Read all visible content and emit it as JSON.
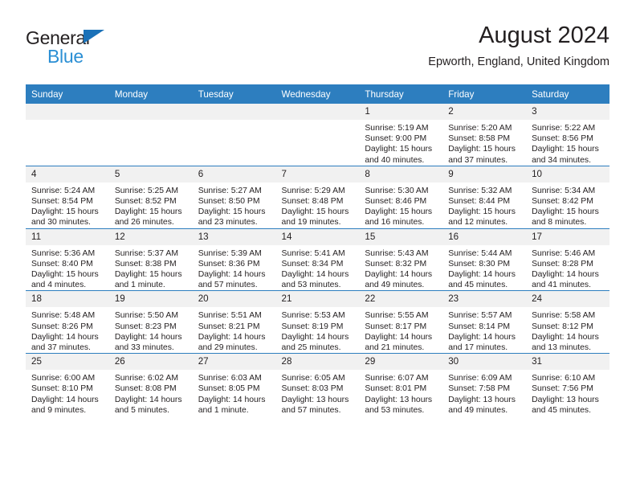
{
  "brand": {
    "name_top": "General",
    "name_bottom": "Blue",
    "triangle_color": "#1a71b8",
    "blue_text_color": "#2b8fd4"
  },
  "header": {
    "title": "August 2024",
    "location": "Epworth, England, United Kingdom"
  },
  "theme": {
    "header_blue": "#2d7ebf",
    "daynum_gray": "#f1f1f1",
    "text": "#231f20"
  },
  "calendar": {
    "weekday_headers": [
      "Sunday",
      "Monday",
      "Tuesday",
      "Wednesday",
      "Thursday",
      "Friday",
      "Saturday"
    ],
    "weeks": [
      [
        {
          "day": "",
          "empty": true
        },
        {
          "day": "",
          "empty": true
        },
        {
          "day": "",
          "empty": true
        },
        {
          "day": "",
          "empty": true
        },
        {
          "day": "1",
          "sunrise": "Sunrise: 5:19 AM",
          "sunset": "Sunset: 9:00 PM",
          "daylight1": "Daylight: 15 hours",
          "daylight2": "and 40 minutes."
        },
        {
          "day": "2",
          "sunrise": "Sunrise: 5:20 AM",
          "sunset": "Sunset: 8:58 PM",
          "daylight1": "Daylight: 15 hours",
          "daylight2": "and 37 minutes."
        },
        {
          "day": "3",
          "sunrise": "Sunrise: 5:22 AM",
          "sunset": "Sunset: 8:56 PM",
          "daylight1": "Daylight: 15 hours",
          "daylight2": "and 34 minutes."
        }
      ],
      [
        {
          "day": "4",
          "sunrise": "Sunrise: 5:24 AM",
          "sunset": "Sunset: 8:54 PM",
          "daylight1": "Daylight: 15 hours",
          "daylight2": "and 30 minutes."
        },
        {
          "day": "5",
          "sunrise": "Sunrise: 5:25 AM",
          "sunset": "Sunset: 8:52 PM",
          "daylight1": "Daylight: 15 hours",
          "daylight2": "and 26 minutes."
        },
        {
          "day": "6",
          "sunrise": "Sunrise: 5:27 AM",
          "sunset": "Sunset: 8:50 PM",
          "daylight1": "Daylight: 15 hours",
          "daylight2": "and 23 minutes."
        },
        {
          "day": "7",
          "sunrise": "Sunrise: 5:29 AM",
          "sunset": "Sunset: 8:48 PM",
          "daylight1": "Daylight: 15 hours",
          "daylight2": "and 19 minutes."
        },
        {
          "day": "8",
          "sunrise": "Sunrise: 5:30 AM",
          "sunset": "Sunset: 8:46 PM",
          "daylight1": "Daylight: 15 hours",
          "daylight2": "and 16 minutes."
        },
        {
          "day": "9",
          "sunrise": "Sunrise: 5:32 AM",
          "sunset": "Sunset: 8:44 PM",
          "daylight1": "Daylight: 15 hours",
          "daylight2": "and 12 minutes."
        },
        {
          "day": "10",
          "sunrise": "Sunrise: 5:34 AM",
          "sunset": "Sunset: 8:42 PM",
          "daylight1": "Daylight: 15 hours",
          "daylight2": "and 8 minutes."
        }
      ],
      [
        {
          "day": "11",
          "sunrise": "Sunrise: 5:36 AM",
          "sunset": "Sunset: 8:40 PM",
          "daylight1": "Daylight: 15 hours",
          "daylight2": "and 4 minutes."
        },
        {
          "day": "12",
          "sunrise": "Sunrise: 5:37 AM",
          "sunset": "Sunset: 8:38 PM",
          "daylight1": "Daylight: 15 hours",
          "daylight2": "and 1 minute."
        },
        {
          "day": "13",
          "sunrise": "Sunrise: 5:39 AM",
          "sunset": "Sunset: 8:36 PM",
          "daylight1": "Daylight: 14 hours",
          "daylight2": "and 57 minutes."
        },
        {
          "day": "14",
          "sunrise": "Sunrise: 5:41 AM",
          "sunset": "Sunset: 8:34 PM",
          "daylight1": "Daylight: 14 hours",
          "daylight2": "and 53 minutes."
        },
        {
          "day": "15",
          "sunrise": "Sunrise: 5:43 AM",
          "sunset": "Sunset: 8:32 PM",
          "daylight1": "Daylight: 14 hours",
          "daylight2": "and 49 minutes."
        },
        {
          "day": "16",
          "sunrise": "Sunrise: 5:44 AM",
          "sunset": "Sunset: 8:30 PM",
          "daylight1": "Daylight: 14 hours",
          "daylight2": "and 45 minutes."
        },
        {
          "day": "17",
          "sunrise": "Sunrise: 5:46 AM",
          "sunset": "Sunset: 8:28 PM",
          "daylight1": "Daylight: 14 hours",
          "daylight2": "and 41 minutes."
        }
      ],
      [
        {
          "day": "18",
          "sunrise": "Sunrise: 5:48 AM",
          "sunset": "Sunset: 8:26 PM",
          "daylight1": "Daylight: 14 hours",
          "daylight2": "and 37 minutes."
        },
        {
          "day": "19",
          "sunrise": "Sunrise: 5:50 AM",
          "sunset": "Sunset: 8:23 PM",
          "daylight1": "Daylight: 14 hours",
          "daylight2": "and 33 minutes."
        },
        {
          "day": "20",
          "sunrise": "Sunrise: 5:51 AM",
          "sunset": "Sunset: 8:21 PM",
          "daylight1": "Daylight: 14 hours",
          "daylight2": "and 29 minutes."
        },
        {
          "day": "21",
          "sunrise": "Sunrise: 5:53 AM",
          "sunset": "Sunset: 8:19 PM",
          "daylight1": "Daylight: 14 hours",
          "daylight2": "and 25 minutes."
        },
        {
          "day": "22",
          "sunrise": "Sunrise: 5:55 AM",
          "sunset": "Sunset: 8:17 PM",
          "daylight1": "Daylight: 14 hours",
          "daylight2": "and 21 minutes."
        },
        {
          "day": "23",
          "sunrise": "Sunrise: 5:57 AM",
          "sunset": "Sunset: 8:14 PM",
          "daylight1": "Daylight: 14 hours",
          "daylight2": "and 17 minutes."
        },
        {
          "day": "24",
          "sunrise": "Sunrise: 5:58 AM",
          "sunset": "Sunset: 8:12 PM",
          "daylight1": "Daylight: 14 hours",
          "daylight2": "and 13 minutes."
        }
      ],
      [
        {
          "day": "25",
          "sunrise": "Sunrise: 6:00 AM",
          "sunset": "Sunset: 8:10 PM",
          "daylight1": "Daylight: 14 hours",
          "daylight2": "and 9 minutes."
        },
        {
          "day": "26",
          "sunrise": "Sunrise: 6:02 AM",
          "sunset": "Sunset: 8:08 PM",
          "daylight1": "Daylight: 14 hours",
          "daylight2": "and 5 minutes."
        },
        {
          "day": "27",
          "sunrise": "Sunrise: 6:03 AM",
          "sunset": "Sunset: 8:05 PM",
          "daylight1": "Daylight: 14 hours",
          "daylight2": "and 1 minute."
        },
        {
          "day": "28",
          "sunrise": "Sunrise: 6:05 AM",
          "sunset": "Sunset: 8:03 PM",
          "daylight1": "Daylight: 13 hours",
          "daylight2": "and 57 minutes."
        },
        {
          "day": "29",
          "sunrise": "Sunrise: 6:07 AM",
          "sunset": "Sunset: 8:01 PM",
          "daylight1": "Daylight: 13 hours",
          "daylight2": "and 53 minutes."
        },
        {
          "day": "30",
          "sunrise": "Sunrise: 6:09 AM",
          "sunset": "Sunset: 7:58 PM",
          "daylight1": "Daylight: 13 hours",
          "daylight2": "and 49 minutes."
        },
        {
          "day": "31",
          "sunrise": "Sunrise: 6:10 AM",
          "sunset": "Sunset: 7:56 PM",
          "daylight1": "Daylight: 13 hours",
          "daylight2": "and 45 minutes."
        }
      ]
    ]
  }
}
